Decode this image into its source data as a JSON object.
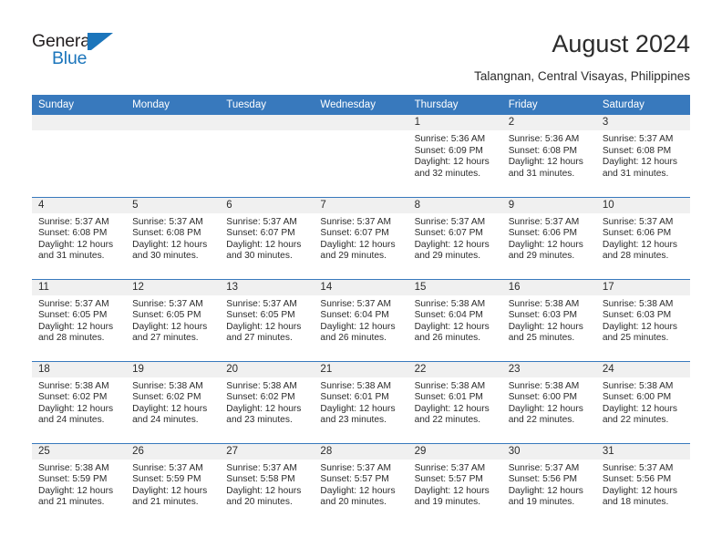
{
  "brand": {
    "name_top": "General",
    "name_bottom": "Blue",
    "mark": "triangle-logo-mark",
    "accent_color": "#1b75bb"
  },
  "header": {
    "title": "August 2024",
    "subtitle": "Talangnan, Central Visayas, Philippines"
  },
  "calendar": {
    "header_bg": "#3879bd",
    "daynum_bg": "#f0f0f0",
    "weekday_headers": [
      "Sunday",
      "Monday",
      "Tuesday",
      "Wednesday",
      "Thursday",
      "Friday",
      "Saturday"
    ],
    "weeks": [
      [
        {
          "day": "",
          "lines": []
        },
        {
          "day": "",
          "lines": []
        },
        {
          "day": "",
          "lines": []
        },
        {
          "day": "",
          "lines": []
        },
        {
          "day": "1",
          "lines": [
            "Sunrise: 5:36 AM",
            "Sunset: 6:09 PM",
            "Daylight: 12 hours",
            "and 32 minutes."
          ]
        },
        {
          "day": "2",
          "lines": [
            "Sunrise: 5:36 AM",
            "Sunset: 6:08 PM",
            "Daylight: 12 hours",
            "and 31 minutes."
          ]
        },
        {
          "day": "3",
          "lines": [
            "Sunrise: 5:37 AM",
            "Sunset: 6:08 PM",
            "Daylight: 12 hours",
            "and 31 minutes."
          ]
        }
      ],
      [
        {
          "day": "4",
          "lines": [
            "Sunrise: 5:37 AM",
            "Sunset: 6:08 PM",
            "Daylight: 12 hours",
            "and 31 minutes."
          ]
        },
        {
          "day": "5",
          "lines": [
            "Sunrise: 5:37 AM",
            "Sunset: 6:08 PM",
            "Daylight: 12 hours",
            "and 30 minutes."
          ]
        },
        {
          "day": "6",
          "lines": [
            "Sunrise: 5:37 AM",
            "Sunset: 6:07 PM",
            "Daylight: 12 hours",
            "and 30 minutes."
          ]
        },
        {
          "day": "7",
          "lines": [
            "Sunrise: 5:37 AM",
            "Sunset: 6:07 PM",
            "Daylight: 12 hours",
            "and 29 minutes."
          ]
        },
        {
          "day": "8",
          "lines": [
            "Sunrise: 5:37 AM",
            "Sunset: 6:07 PM",
            "Daylight: 12 hours",
            "and 29 minutes."
          ]
        },
        {
          "day": "9",
          "lines": [
            "Sunrise: 5:37 AM",
            "Sunset: 6:06 PM",
            "Daylight: 12 hours",
            "and 29 minutes."
          ]
        },
        {
          "day": "10",
          "lines": [
            "Sunrise: 5:37 AM",
            "Sunset: 6:06 PM",
            "Daylight: 12 hours",
            "and 28 minutes."
          ]
        }
      ],
      [
        {
          "day": "11",
          "lines": [
            "Sunrise: 5:37 AM",
            "Sunset: 6:05 PM",
            "Daylight: 12 hours",
            "and 28 minutes."
          ]
        },
        {
          "day": "12",
          "lines": [
            "Sunrise: 5:37 AM",
            "Sunset: 6:05 PM",
            "Daylight: 12 hours",
            "and 27 minutes."
          ]
        },
        {
          "day": "13",
          "lines": [
            "Sunrise: 5:37 AM",
            "Sunset: 6:05 PM",
            "Daylight: 12 hours",
            "and 27 minutes."
          ]
        },
        {
          "day": "14",
          "lines": [
            "Sunrise: 5:37 AM",
            "Sunset: 6:04 PM",
            "Daylight: 12 hours",
            "and 26 minutes."
          ]
        },
        {
          "day": "15",
          "lines": [
            "Sunrise: 5:38 AM",
            "Sunset: 6:04 PM",
            "Daylight: 12 hours",
            "and 26 minutes."
          ]
        },
        {
          "day": "16",
          "lines": [
            "Sunrise: 5:38 AM",
            "Sunset: 6:03 PM",
            "Daylight: 12 hours",
            "and 25 minutes."
          ]
        },
        {
          "day": "17",
          "lines": [
            "Sunrise: 5:38 AM",
            "Sunset: 6:03 PM",
            "Daylight: 12 hours",
            "and 25 minutes."
          ]
        }
      ],
      [
        {
          "day": "18",
          "lines": [
            "Sunrise: 5:38 AM",
            "Sunset: 6:02 PM",
            "Daylight: 12 hours",
            "and 24 minutes."
          ]
        },
        {
          "day": "19",
          "lines": [
            "Sunrise: 5:38 AM",
            "Sunset: 6:02 PM",
            "Daylight: 12 hours",
            "and 24 minutes."
          ]
        },
        {
          "day": "20",
          "lines": [
            "Sunrise: 5:38 AM",
            "Sunset: 6:02 PM",
            "Daylight: 12 hours",
            "and 23 minutes."
          ]
        },
        {
          "day": "21",
          "lines": [
            "Sunrise: 5:38 AM",
            "Sunset: 6:01 PM",
            "Daylight: 12 hours",
            "and 23 minutes."
          ]
        },
        {
          "day": "22",
          "lines": [
            "Sunrise: 5:38 AM",
            "Sunset: 6:01 PM",
            "Daylight: 12 hours",
            "and 22 minutes."
          ]
        },
        {
          "day": "23",
          "lines": [
            "Sunrise: 5:38 AM",
            "Sunset: 6:00 PM",
            "Daylight: 12 hours",
            "and 22 minutes."
          ]
        },
        {
          "day": "24",
          "lines": [
            "Sunrise: 5:38 AM",
            "Sunset: 6:00 PM",
            "Daylight: 12 hours",
            "and 22 minutes."
          ]
        }
      ],
      [
        {
          "day": "25",
          "lines": [
            "Sunrise: 5:38 AM",
            "Sunset: 5:59 PM",
            "Daylight: 12 hours",
            "and 21 minutes."
          ]
        },
        {
          "day": "26",
          "lines": [
            "Sunrise: 5:37 AM",
            "Sunset: 5:59 PM",
            "Daylight: 12 hours",
            "and 21 minutes."
          ]
        },
        {
          "day": "27",
          "lines": [
            "Sunrise: 5:37 AM",
            "Sunset: 5:58 PM",
            "Daylight: 12 hours",
            "and 20 minutes."
          ]
        },
        {
          "day": "28",
          "lines": [
            "Sunrise: 5:37 AM",
            "Sunset: 5:57 PM",
            "Daylight: 12 hours",
            "and 20 minutes."
          ]
        },
        {
          "day": "29",
          "lines": [
            "Sunrise: 5:37 AM",
            "Sunset: 5:57 PM",
            "Daylight: 12 hours",
            "and 19 minutes."
          ]
        },
        {
          "day": "30",
          "lines": [
            "Sunrise: 5:37 AM",
            "Sunset: 5:56 PM",
            "Daylight: 12 hours",
            "and 19 minutes."
          ]
        },
        {
          "day": "31",
          "lines": [
            "Sunrise: 5:37 AM",
            "Sunset: 5:56 PM",
            "Daylight: 12 hours",
            "and 18 minutes."
          ]
        }
      ]
    ]
  }
}
